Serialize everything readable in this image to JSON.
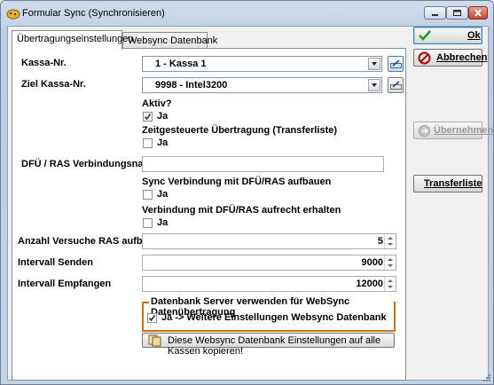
{
  "window": {
    "title": "Formular Sync (Synchronisieren)"
  },
  "tabs": [
    {
      "label": "Übertragungseinstellungen",
      "active": true
    },
    {
      "label": "Websync Datenbank",
      "active": false
    }
  ],
  "form": {
    "kassa_label": "Kassa-Nr.",
    "kassa_value": "1 - Kassa 1",
    "ziel_label": "Ziel Kassa-Nr.",
    "ziel_value": "9998 - Intel3200",
    "aktiv_label": "Aktiv?",
    "aktiv_check_label": "Ja",
    "zeit_label": "Zeitgesteuerte Übertragung (Transferliste)",
    "zeit_check_label": "Ja",
    "dfue_label": "DFÜ / RAS Verbindungsname",
    "dfue_value": "",
    "sync_dfue_label": "Sync Verbindung mit DFÜ/RAS aufbauen",
    "sync_dfue_check_label": "Ja",
    "keep_dfue_label": "Verbindung mit DFÜ/RAS aufrecht erhalten",
    "keep_dfue_check_label": "Ja",
    "anzahl_label": "Anzahl Versuche RAS aufbauen",
    "anzahl_value": "5",
    "senden_label": "Intervall Senden",
    "senden_value": "9000",
    "empfangen_label": "Intervall Empfangen",
    "empfangen_value": "12000",
    "websync_group_label": "Datenbank Server verwenden für WebSync Datenübertragung",
    "websync_check_label": "Ja -> Weitere Einstellungen Websync Datenbank",
    "copy_button_label": "Diese Websync Datenbank Einstellungen auf alle Kassen kopieren!"
  },
  "checks": {
    "aktiv": true,
    "zeit": false,
    "sync_dfue": false,
    "keep_dfue": false,
    "websync": true
  },
  "side_buttons": {
    "ok": "Ok",
    "abbrechen": "Abbrechen",
    "uebernehmen": "Übernehmen",
    "transferliste": "Transferliste"
  },
  "colors": {
    "accent_orange": "#d6700a",
    "ok_check": "#1f9a1f",
    "cancel_red": "#b40000"
  }
}
